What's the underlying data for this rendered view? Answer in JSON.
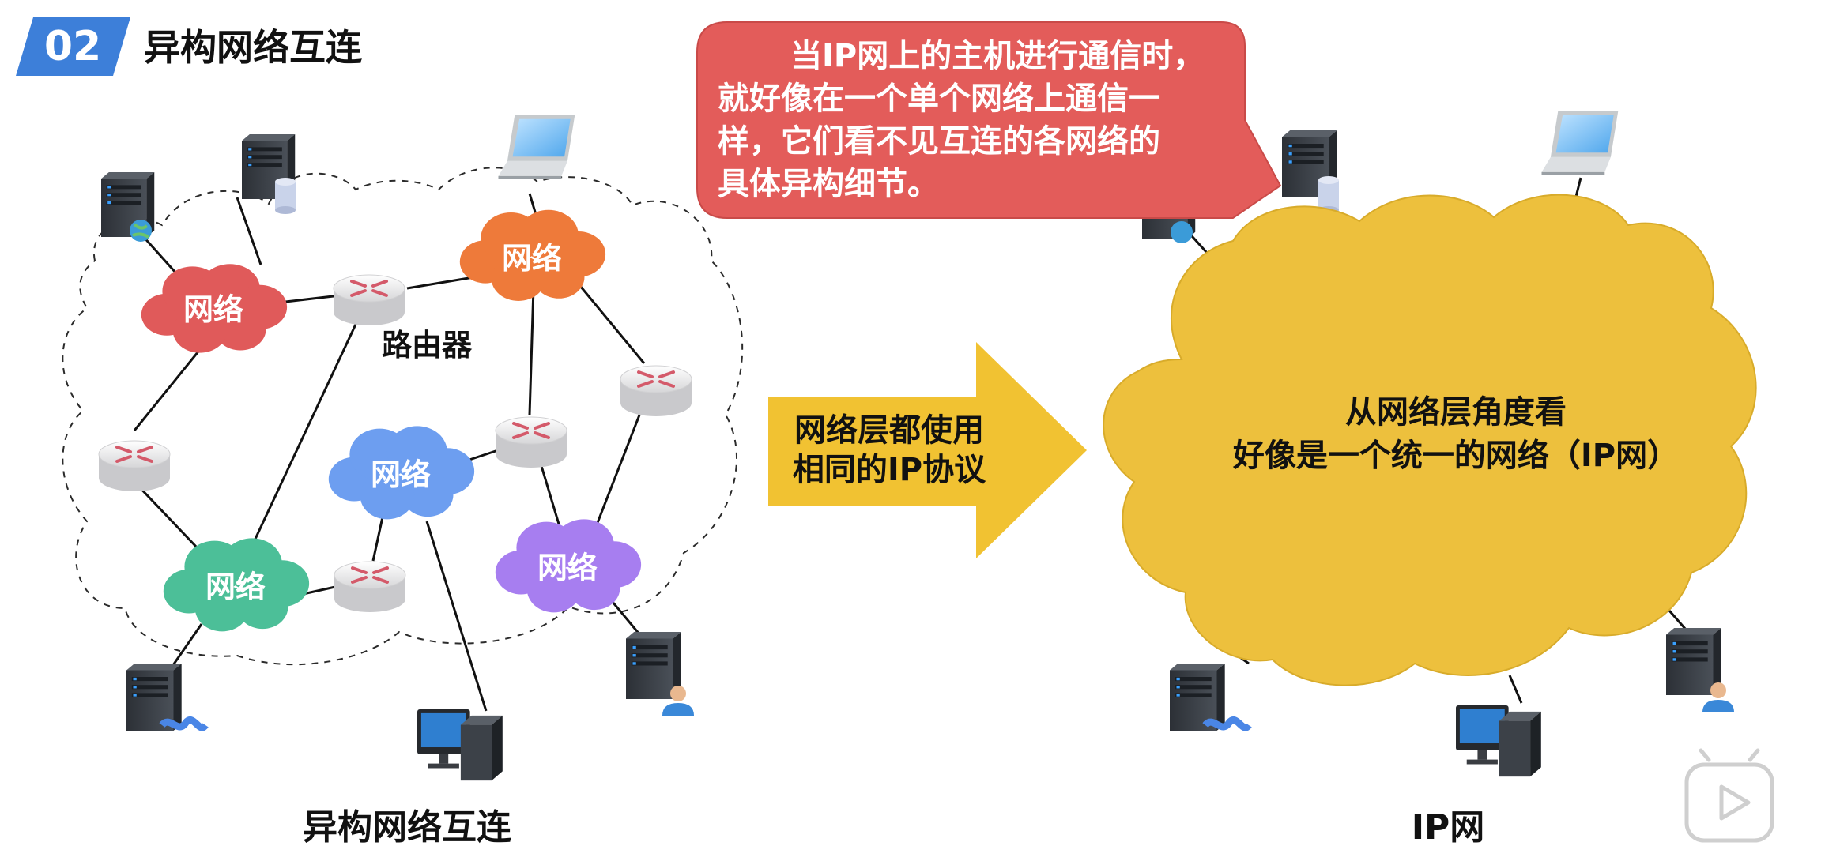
{
  "section": {
    "number": "02",
    "title": "异构网络互连"
  },
  "network_label": "网络",
  "router_label": "路由器",
  "left_caption": "异构网络互连",
  "right_caption": "IP网",
  "arrow_text": [
    "网络层都使用",
    "相同的IP协议"
  ],
  "callout_text": [
    "当IP网上的主机进行通信时，",
    "就好像在一个单个网络上通信一",
    "样，它们看不见互连的各网络的",
    "具体异构细节。"
  ],
  "cloud_text": [
    "从网络层角度看",
    "好像是一个统一的网络（IP网）"
  ],
  "colors": {
    "badge": "#3d7fd9",
    "net_red": "#e05a5a",
    "net_orange": "#ee7a3a",
    "net_blue": "#6d9ef0",
    "net_green": "#4cbf98",
    "net_purple": "#a77ef0",
    "callout": "#e35c5a",
    "arrow": "#f1c232",
    "ip_cloud": "#edc03d"
  }
}
